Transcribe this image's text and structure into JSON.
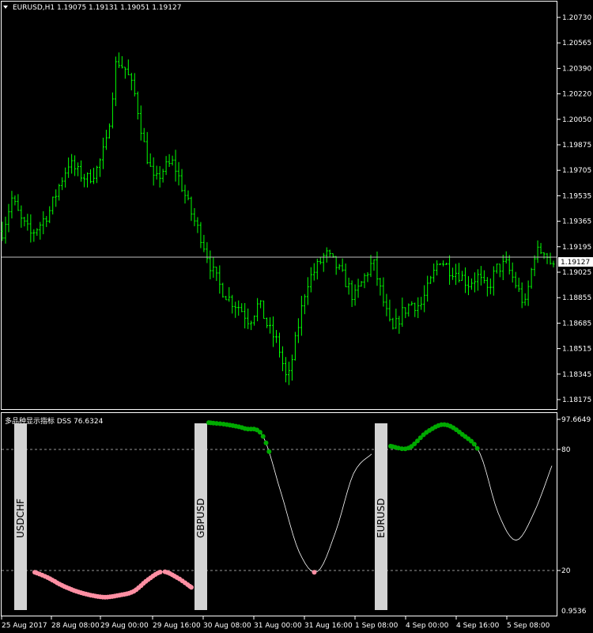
{
  "main_chart": {
    "header": "EURUSD,H1  1.19075 1.19131 1.19051 1.19127",
    "current_price": "1.19127",
    "current_price_value": 1.19127,
    "colors": {
      "background": "#000000",
      "candle": "#00ff00",
      "frame": "#ffffff",
      "price_line": "#c0c0c0"
    }
  },
  "indicator": {
    "header": "多品种显示指标 DSS 76.6324",
    "levels": [
      80,
      20
    ],
    "range": [
      0,
      97.6649
    ],
    "axis_labels": {
      "top": "97.6649",
      "l80": "80",
      "l20": "20",
      "bottom": "0.9536"
    },
    "symbols": [
      "USDCHF",
      "GBPUSD",
      "EURUSD"
    ],
    "colors": {
      "up": "#00aa00",
      "down": "#ff8fa3",
      "line": "#ffffff",
      "panel": "#d3d3d3"
    }
  },
  "time_axis": [
    "25 Aug 2017",
    "28 Aug 08:00",
    "29 Aug 00:00",
    "29 Aug 16:00",
    "30 Aug 08:00",
    "31 Aug 00:00",
    "31 Aug 16:00",
    "1 Sep 08:00",
    "4 Sep 00:00",
    "4 Sep 16:00",
    "5 Sep 08:00"
  ],
  "chart_data": {
    "type": "line",
    "title": "EURUSD,H1",
    "ylim": [
      1.18175,
      1.2073
    ],
    "y_ticks": [
      1.2073,
      1.20565,
      1.2039,
      1.2022,
      1.2005,
      1.19875,
      1.19705,
      1.19535,
      1.19365,
      1.19195,
      1.19025,
      1.18855,
      1.18685,
      1.18515,
      1.18345,
      1.18175
    ],
    "close_approx": [
      1.193,
      1.1952,
      1.1937,
      1.1928,
      1.1935,
      1.1944,
      1.1961,
      1.1976,
      1.1969,
      1.1965,
      1.1972,
      1.199,
      1.2045,
      1.2038,
      1.202,
      1.1985,
      1.1962,
      1.1972,
      1.1976,
      1.1958,
      1.194,
      1.1925,
      1.1905,
      1.1892,
      1.1884,
      1.1879,
      1.187,
      1.1882,
      1.1865,
      1.1855,
      1.1828,
      1.1862,
      1.1895,
      1.1905,
      1.1915,
      1.1908,
      1.1898,
      1.1885,
      1.1898,
      1.191,
      1.1885,
      1.1862,
      1.1875,
      1.1882,
      1.188,
      1.1895,
      1.1912,
      1.1905,
      1.1902,
      1.1895,
      1.19,
      1.189,
      1.1905,
      1.1908,
      1.1895,
      1.188,
      1.1915,
      1.1918,
      1.1905
    ],
    "indicator_values_approx": [
      20,
      17,
      13,
      10,
      8,
      7,
      8,
      10,
      16,
      20,
      17,
      12,
      96,
      95,
      93,
      89,
      60,
      30,
      20,
      40,
      70,
      80,
      84,
      83,
      91,
      95,
      90,
      80,
      50,
      36,
      50,
      74
    ]
  }
}
